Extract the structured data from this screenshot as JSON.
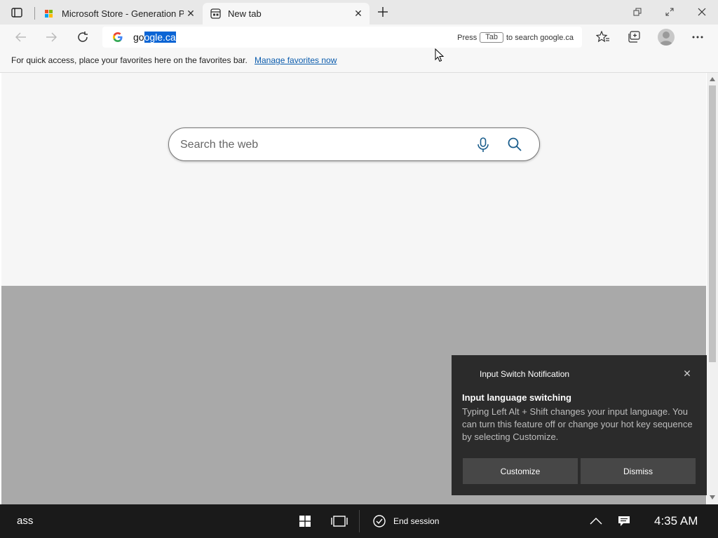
{
  "tabs": [
    {
      "title": "Microsoft Store - Generation Pro",
      "favicon": "store-icon",
      "active": false
    },
    {
      "title": "New tab",
      "favicon": "newtab-icon",
      "active": true
    }
  ],
  "addressbar": {
    "url_prefix": "go",
    "url_selected": "ogle.ca",
    "hint_press": "Press",
    "hint_key": "Tab",
    "hint_suffix": "to search google.ca"
  },
  "favorites_bar": {
    "message": "For quick access, place your favorites here on the favorites bar.",
    "link": "Manage favorites now"
  },
  "search": {
    "placeholder": "Search the web"
  },
  "notification": {
    "app_name": "Input Switch Notification",
    "title": "Input language switching",
    "body": "Typing Left Alt + Shift changes your input language. You can turn this feature off or change your hot key sequence by selecting Customize.",
    "buttons": [
      "Customize",
      "Dismiss"
    ]
  },
  "taskbar": {
    "left_text": "ass",
    "end_session": "End session",
    "time": "4:35 AM"
  },
  "colors": {
    "selection": "#0a64d4",
    "link": "#0b5cad",
    "taskbar": "#1a1a1a",
    "notification": "#2b2b2b"
  }
}
